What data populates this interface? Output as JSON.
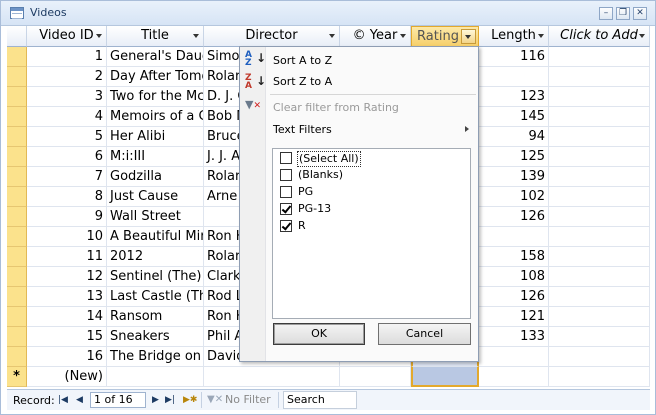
{
  "window": {
    "title": "Videos"
  },
  "columns": [
    {
      "key": "video_id",
      "label": "Video ID"
    },
    {
      "key": "title",
      "label": "Title"
    },
    {
      "key": "director",
      "label": "Director"
    },
    {
      "key": "year",
      "label": "© Year"
    },
    {
      "key": "rating",
      "label": "Rating"
    },
    {
      "key": "length",
      "label": "Length"
    },
    {
      "key": "add",
      "label": "Click to Add"
    }
  ],
  "rows": [
    {
      "id": "1",
      "title": "General's Daug",
      "director": "Simo",
      "length": "116"
    },
    {
      "id": "2",
      "title": "Day After Tomo",
      "director": "Rolar",
      "length": ""
    },
    {
      "id": "3",
      "title": "Two for the Mc",
      "director": "D. J. C",
      "length": "123"
    },
    {
      "id": "4",
      "title": "Memoirs of a G",
      "director": "Bob M",
      "length": "145"
    },
    {
      "id": "5",
      "title": "Her Alibi",
      "director": "Bruce",
      "length": "94"
    },
    {
      "id": "6",
      "title": "M:i:III",
      "director": "J. J. A",
      "length": "125"
    },
    {
      "id": "7",
      "title": "Godzilla",
      "director": "Rolar",
      "length": "139"
    },
    {
      "id": "8",
      "title": "Just Cause",
      "director": "Arne",
      "length": "102"
    },
    {
      "id": "9",
      "title": "Wall Street",
      "director": "",
      "length": "126"
    },
    {
      "id": "10",
      "title": "A Beautiful Mir",
      "director": "Ron H",
      "length": ""
    },
    {
      "id": "11",
      "title": "2012",
      "director": "Rolar",
      "length": "158"
    },
    {
      "id": "12",
      "title": "Sentinel (The)",
      "director": "Clark",
      "length": "108"
    },
    {
      "id": "13",
      "title": "Last Castle (The",
      "director": "Rod L",
      "length": "126"
    },
    {
      "id": "14",
      "title": "Ransom",
      "director": "Ron H",
      "length": "121"
    },
    {
      "id": "15",
      "title": "Sneakers",
      "director": "Phil A",
      "length": "133"
    },
    {
      "id": "16",
      "title": "The Bridge on t",
      "director": "David",
      "length": ""
    }
  ],
  "new_row": {
    "marker": "*",
    "label": "(New)"
  },
  "status": {
    "record_label": "Record:",
    "record_value": "1 of 16",
    "filter_label": "No Filter",
    "search_placeholder": "Search"
  },
  "filter_menu": {
    "sort_asc": "Sort A to Z",
    "sort_desc": "Sort Z to A",
    "clear_filter": "Clear filter from Rating",
    "text_filters": "Text Filters",
    "values": [
      {
        "label": "(Select All)",
        "checked": false
      },
      {
        "label": "(Blanks)",
        "checked": false
      },
      {
        "label": "PG",
        "checked": false
      },
      {
        "label": "PG-13",
        "checked": true
      },
      {
        "label": "R",
        "checked": true
      }
    ],
    "ok_label": "OK",
    "cancel_label": "Cancel"
  },
  "colors": {
    "selector": "#fbe28c",
    "rating_header": "#f6cf6a",
    "rating_border": "#e3a92d"
  }
}
